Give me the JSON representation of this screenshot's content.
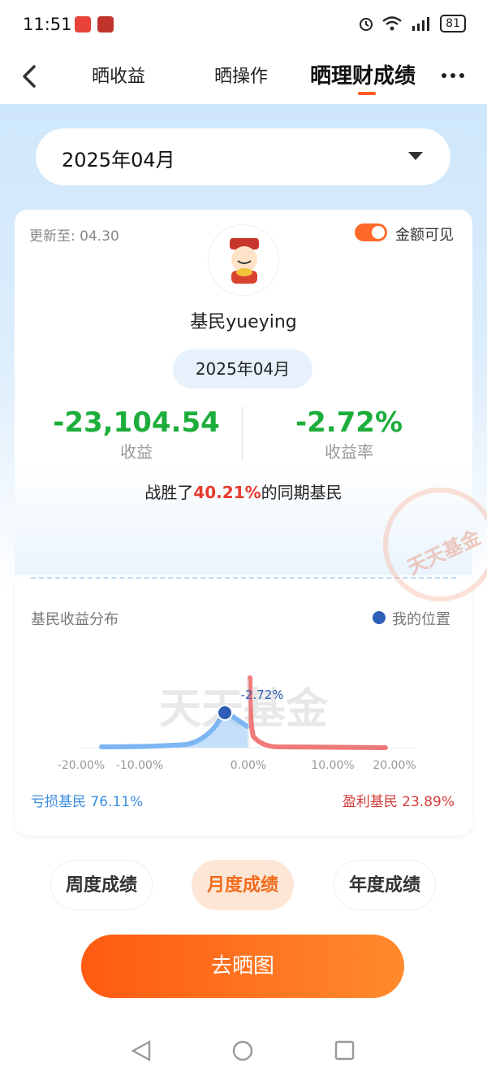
{
  "status": {
    "time": "11:51",
    "battery": "81"
  },
  "nav": {
    "tabs": [
      {
        "label": "晒收益"
      },
      {
        "label": "晒操作"
      },
      {
        "label": "晒理财成绩"
      }
    ]
  },
  "month_selector": {
    "value": "2025年04月"
  },
  "card": {
    "update_prefix": "更新至:",
    "update_date": "04.30",
    "amount_toggle_label": "金额可见",
    "username": "基民yueying",
    "month": "2025年04月",
    "profit_value": "-23,104.54",
    "profit_label": "收益",
    "rate_value": "-2.72%",
    "rate_label": "收益率",
    "beat_prefix": "战胜了",
    "beat_percent": "40.21%",
    "beat_suffix": "的同期基民",
    "stamp_text": "天天基金"
  },
  "distribution": {
    "title": "基民收益分布",
    "legend_label": "我的位置",
    "watermark": "天天基金",
    "marker_label": "-2.72%",
    "loss_label": "亏损基民",
    "loss_percent": "76.11%",
    "gain_label": "盈利基民",
    "gain_percent": "23.89%"
  },
  "chart_data": {
    "type": "area",
    "x_ticks": [
      "-20.00%",
      "-10.00%",
      "0.00%",
      "10.00%",
      "20.00%"
    ],
    "marker": {
      "x": -2.72,
      "label": "-2.72%"
    },
    "series": [
      {
        "name": "亏损基民",
        "color": "#3c8de0"
      },
      {
        "name": "盈利基民",
        "color": "#f07070"
      }
    ]
  },
  "period_buttons": [
    {
      "label": "周度成绩"
    },
    {
      "label": "月度成绩"
    },
    {
      "label": "年度成绩"
    }
  ],
  "share_button": "去晒图",
  "colors": {
    "accent": "#ff5a1f",
    "loss": "#1cae3b",
    "highlight": "#e63b2e"
  }
}
